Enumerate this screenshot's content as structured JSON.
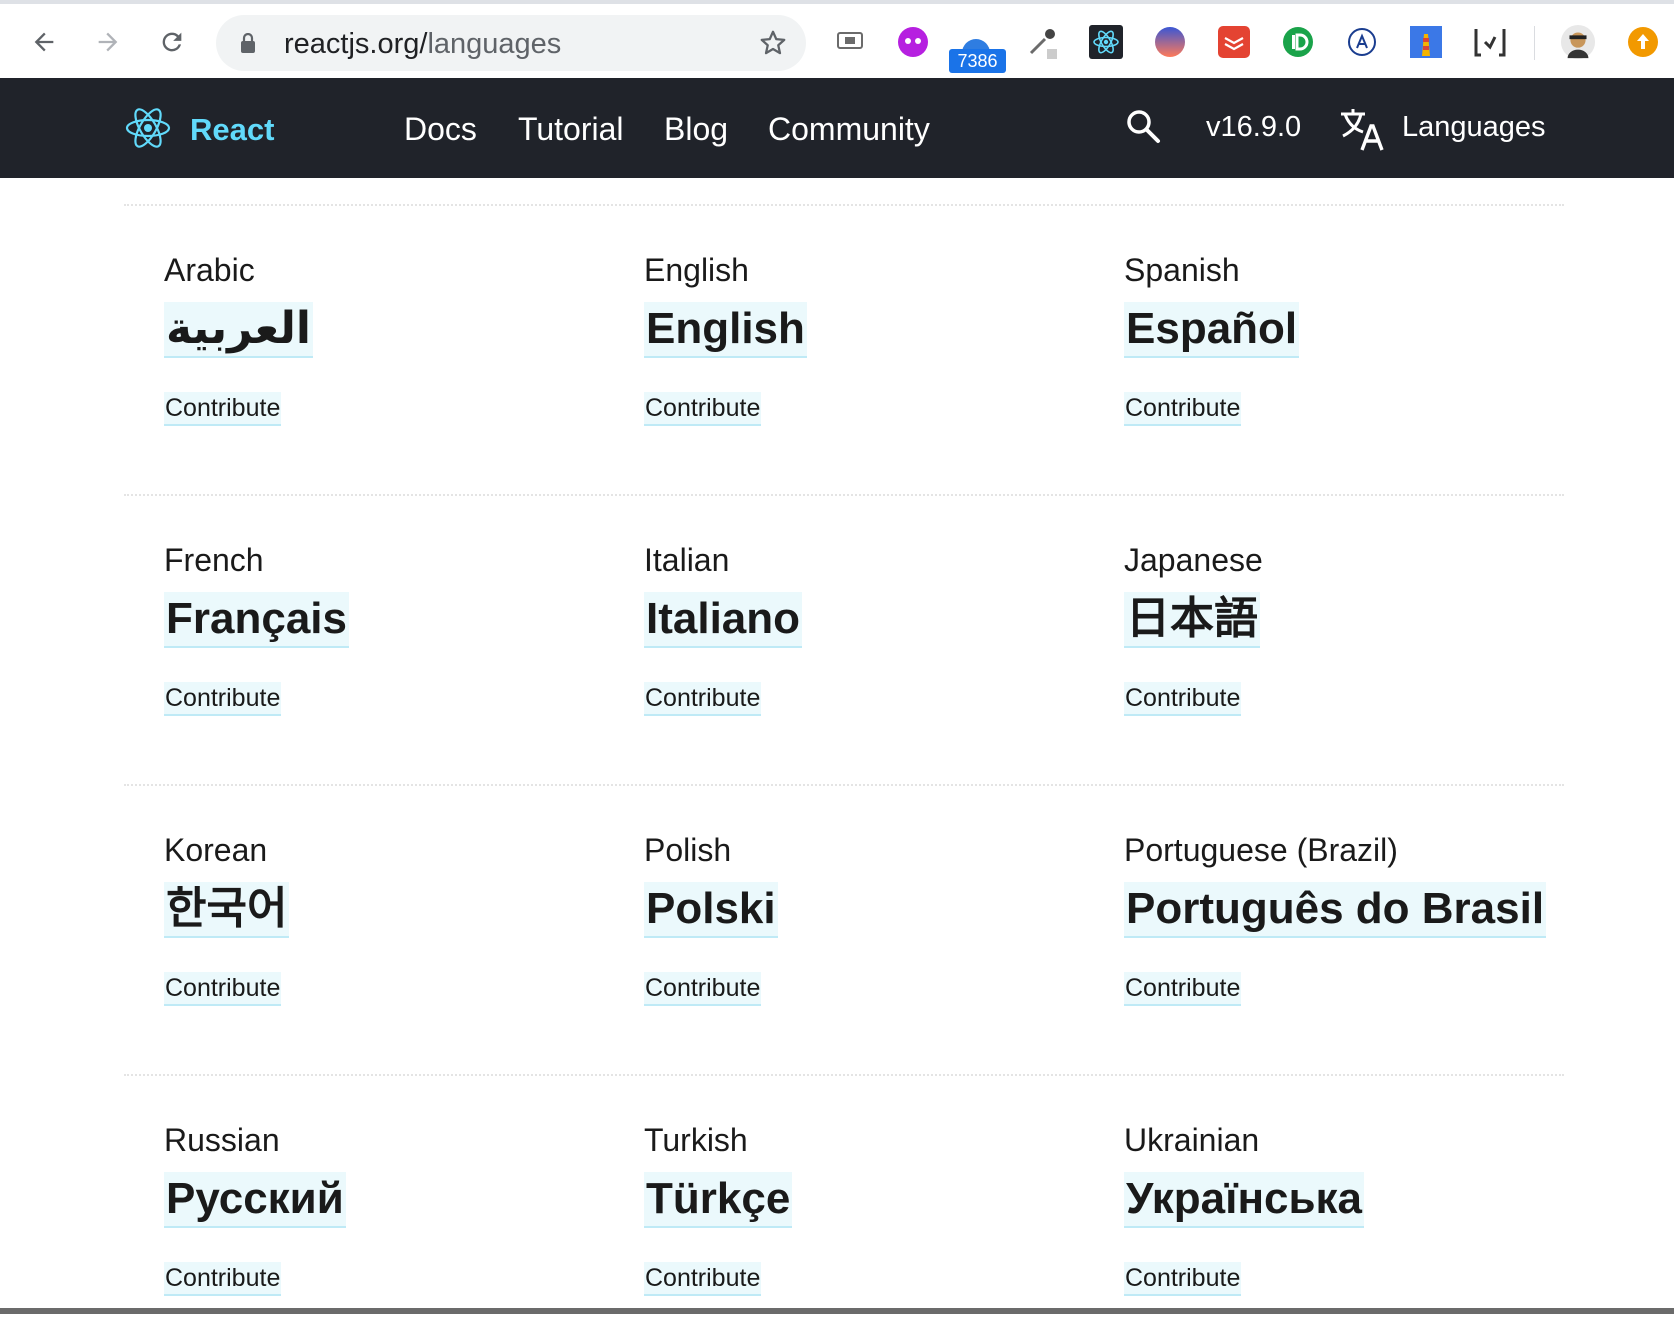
{
  "browser": {
    "url_host": "reactjs.org/",
    "url_path": "languages",
    "extension_badge": "7386"
  },
  "header": {
    "brand": "React",
    "nav": [
      "Docs",
      "Tutorial",
      "Blog",
      "Community"
    ],
    "version": "v16.9.0",
    "languages_label": "Languages"
  },
  "languages": [
    {
      "name": "Arabic",
      "native": "العربية",
      "contribute": "Contribute"
    },
    {
      "name": "English",
      "native": "English",
      "contribute": "Contribute"
    },
    {
      "name": "Spanish",
      "native": "Español",
      "contribute": "Contribute"
    },
    {
      "name": "French",
      "native": "Français",
      "contribute": "Contribute"
    },
    {
      "name": "Italian",
      "native": "Italiano",
      "contribute": "Contribute"
    },
    {
      "name": "Japanese",
      "native": "日本語",
      "contribute": "Contribute"
    },
    {
      "name": "Korean",
      "native": "한국어",
      "contribute": "Contribute"
    },
    {
      "name": "Polish",
      "native": "Polski",
      "contribute": "Contribute"
    },
    {
      "name": "Portuguese (Brazil)",
      "native": "Português do Brasil",
      "contribute": "Contribute"
    },
    {
      "name": "Russian",
      "native": "Русский",
      "contribute": "Contribute"
    },
    {
      "name": "Turkish",
      "native": "Türkçe",
      "contribute": "Contribute"
    },
    {
      "name": "Ukrainian",
      "native": "Українська",
      "contribute": "Contribute"
    }
  ],
  "colors": {
    "navbar_bg": "#20232a",
    "brand_accent": "#61dafb",
    "link_highlight": "#ebf9fc"
  }
}
